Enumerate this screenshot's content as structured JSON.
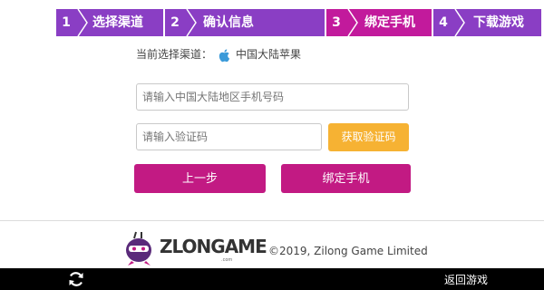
{
  "steps": [
    {
      "num": "1",
      "label": "选择渠道"
    },
    {
      "num": "2",
      "label": "确认信息"
    },
    {
      "num": "3",
      "label": "绑定手机"
    },
    {
      "num": "4",
      "label": "下载游戏"
    }
  ],
  "active_step": 3,
  "channel": {
    "label": "当前选择渠道：",
    "icon": "apple-icon",
    "name": "中国大陆苹果"
  },
  "phone_input": {
    "placeholder": "请输入中国大陆地区手机号码",
    "value": ""
  },
  "code_input": {
    "placeholder": "请输入验证码",
    "value": ""
  },
  "get_code_label": "获取验证码",
  "prev_label": "上一步",
  "bind_label": "绑定手机",
  "footer": {
    "logo_text": "ZLONGAME",
    "logo_sub": ".com",
    "copyright": "©2019, Zilong Game Limited"
  },
  "bottom_bar": {
    "refresh_icon": "refresh-icon",
    "return_label": "返回游戏"
  },
  "colors": {
    "step_default": "#8a3ec4",
    "step_active": "#c21a9c",
    "primary_button": "#c21a83",
    "get_code_button": "#f6b233"
  }
}
